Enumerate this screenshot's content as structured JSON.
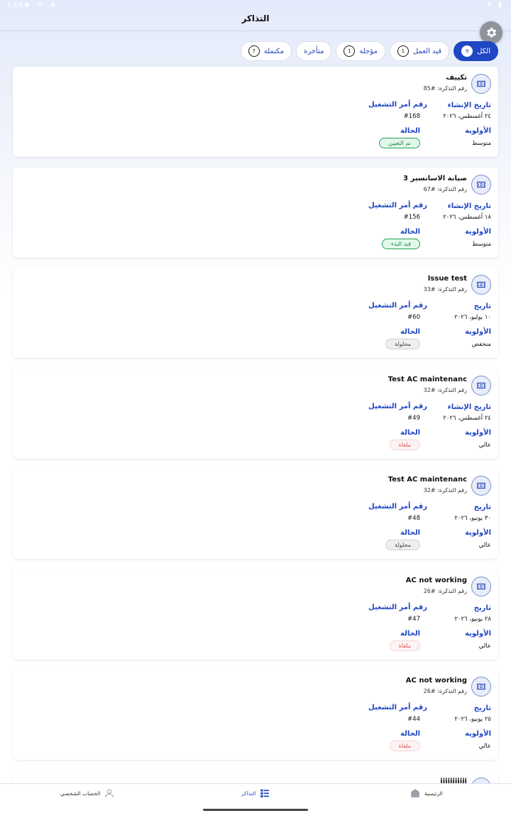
{
  "status_bar": {
    "time": "1:04"
  },
  "app_bar": {
    "title": "التذاكر"
  },
  "tabs": [
    {
      "label": "الكل",
      "count": "9"
    },
    {
      "label": "قيد العمل",
      "count": "1"
    },
    {
      "label": "مؤجلة",
      "count": "1"
    },
    {
      "label": "متأخرة",
      "count": ""
    },
    {
      "label": "مكتملة",
      "count": "7"
    }
  ],
  "tickets": [
    {
      "title": "تكييف",
      "number": "رقم التذكرة: #85",
      "date_label": "تاريخ الإنشاء",
      "date": "٢٤ أغسطس، ٢٠٢٦",
      "order_label": "رقم أمر التشغيل",
      "order": "#168",
      "priority_label": "الأولوية",
      "priority": "متوسط",
      "status_label": "الحالة",
      "status": "تم التعيين",
      "status_color": "#25a05b"
    },
    {
      "title": "صيانة الاسانسير 3",
      "number": "رقم التذكرة: #67",
      "date_label": "تاريخ الإنشاء",
      "date": "١٨ أغسطس، ٢٠٢٦",
      "order_label": "رقم أمر التشغيل",
      "order": "#156",
      "priority_label": "الأولوية",
      "priority": "متوسط",
      "status_label": "الحالة",
      "status": "قيد البدء",
      "status_color": "#25a05b"
    },
    {
      "title": "Issue test",
      "number": "رقم التذكرة: #33",
      "date_label": "تاريخ",
      "date": "١٠ يوليو، ٢٠٢٦",
      "order_label": "رقم أمر التشغيل",
      "order": "#60",
      "priority_label": "الأولوية",
      "priority": "منخفض",
      "status_label": "الحالة",
      "status": "محلولة",
      "status_color": "#d0d0d0"
    },
    {
      "title": "Test AC maintenanc",
      "number": "رقم التذكرة: #32",
      "date_label": "تاريخ الإنشاء",
      "date": "٢٤ أغسطس، ٢٠٢٦",
      "order_label": "رقم أمر التشغيل",
      "order": "#49",
      "priority_label": "الأولوية",
      "priority": "عالي",
      "status_label": "الحالة",
      "status": "ملغاة",
      "status_color": "#e05555"
    },
    {
      "title": "Test AC maintenanc",
      "number": "رقم التذكرة: #32",
      "date_label": "تاريخ",
      "date": "٣٠ يونيو، ٢٠٢٦",
      "order_label": "رقم أمر التشغيل",
      "order": "#48",
      "priority_label": "الأولوية",
      "priority": "عالي",
      "status_label": "الحالة",
      "status": "محلولة",
      "status_color": "#d0d0d0"
    },
    {
      "title": "AC not working",
      "number": "رقم التذكرة: #26",
      "date_label": "تاريخ",
      "date": "٢٨ يونيو، ٢٠٢٦",
      "order_label": "رقم أمر التشغيل",
      "order": "#47",
      "priority_label": "الأولوية",
      "priority": "عالي",
      "status_label": "الحالة",
      "status": "ملغاة",
      "status_color": "#e05555"
    },
    {
      "title": "AC not working",
      "number": "رقم التذكرة: #26",
      "date_label": "تاريخ",
      "date": "٢٥ يونيو، ٢٠٢٦",
      "order_label": "رقم أمر التشغيل",
      "order": "#44",
      "priority_label": "الأولوية",
      "priority": "عالي",
      "status_label": "الحالة",
      "status": "ملغاة",
      "status_color": "#e05555"
    }
  ],
  "partial_ticket": {
    "title": "iiiiiiiiiii"
  },
  "bottom_nav": {
    "home": "الرئيسية",
    "tickets": "التذاكر",
    "profile": "الحساب الشخصي"
  },
  "colors": {
    "primary": "#1f46c3",
    "link": "#1f46c3",
    "green": "#25a05b",
    "red": "#e05555"
  }
}
